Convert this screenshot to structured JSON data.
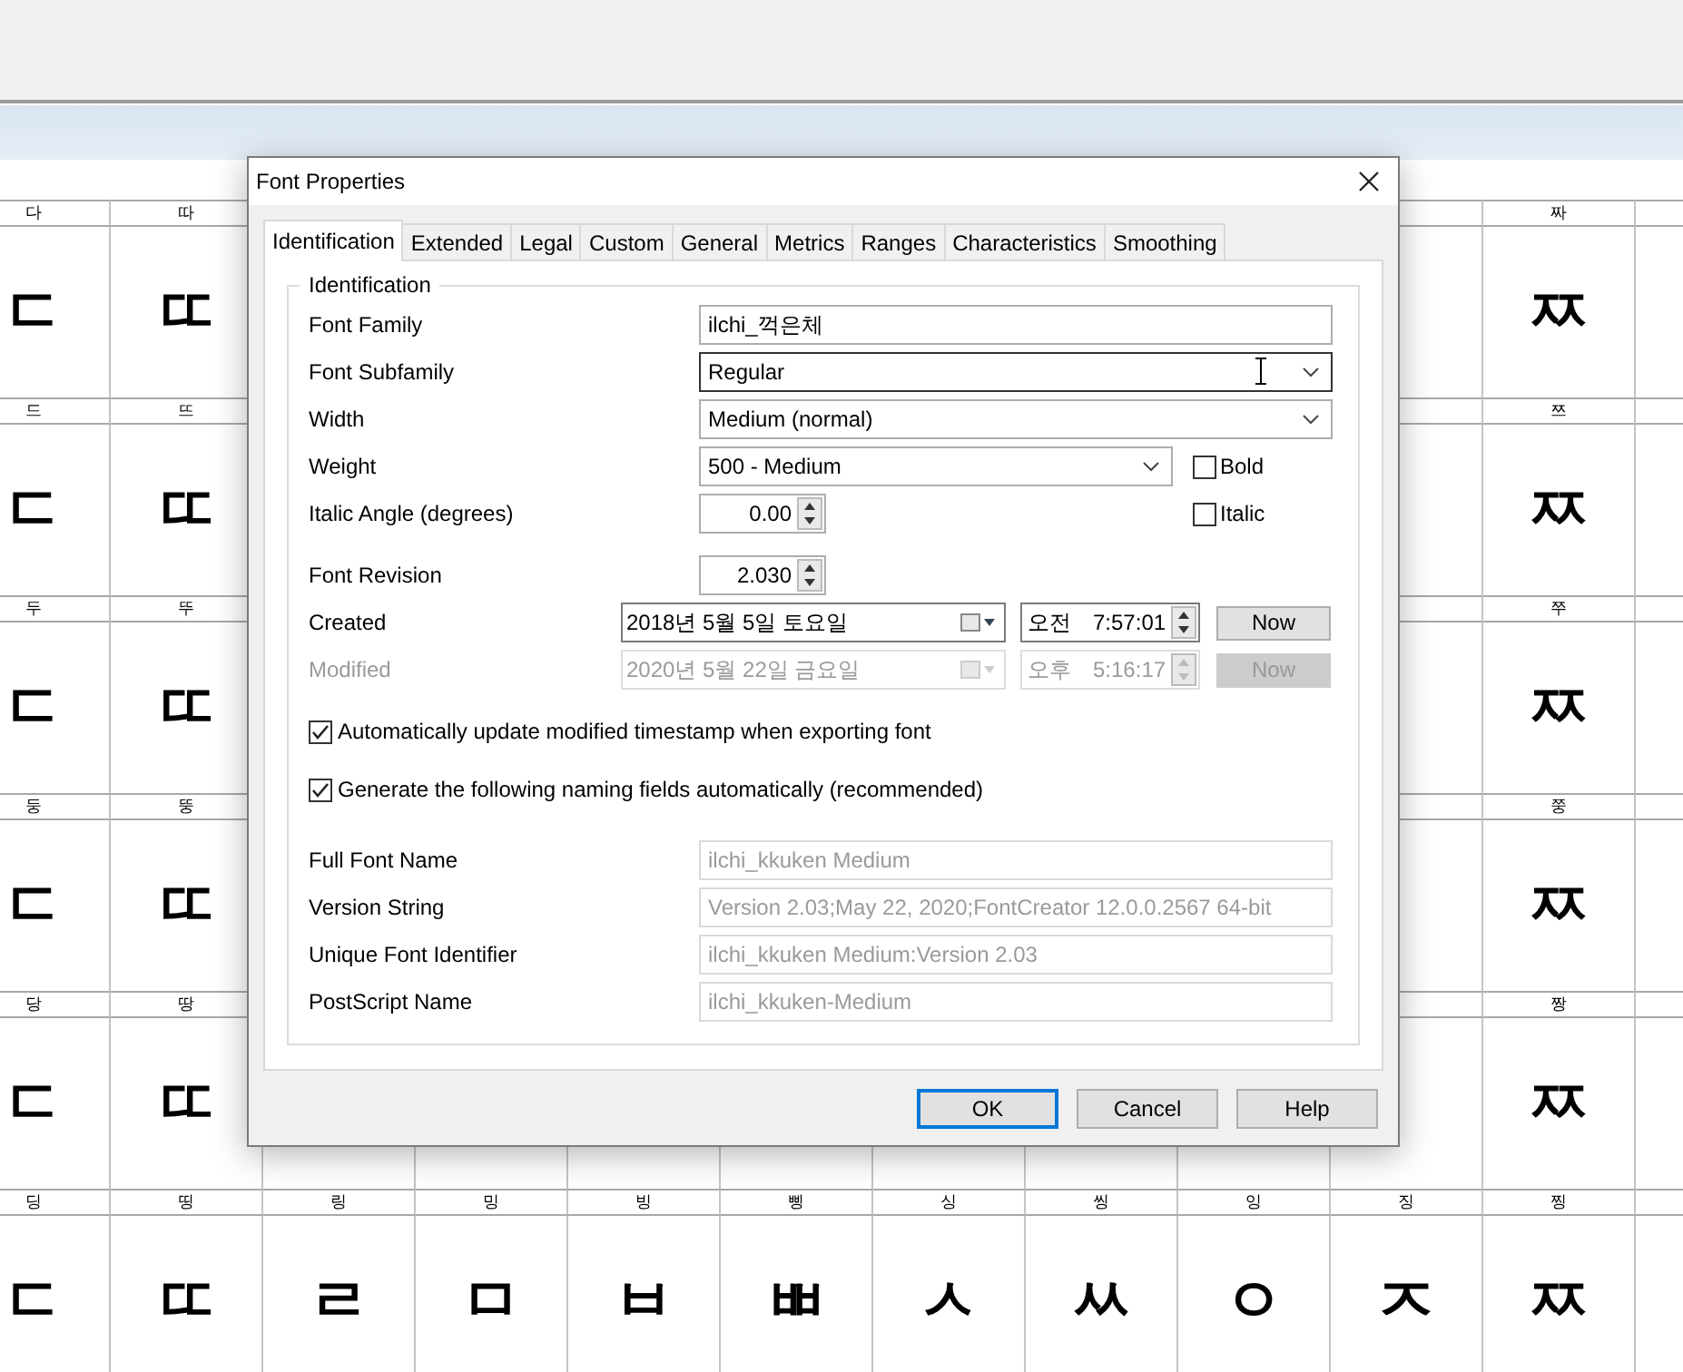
{
  "background": {
    "rows": [
      {
        "left": [
          {
            "heading": "다",
            "glyph": "ㄷ"
          },
          {
            "heading": "따",
            "glyph": "ㄸ"
          }
        ],
        "right": [
          {
            "heading": "짜",
            "glyph": "ㅉ"
          }
        ]
      },
      {
        "left": [
          {
            "heading": "드",
            "glyph": "ㄷ"
          },
          {
            "heading": "뜨",
            "glyph": "ㄸ"
          }
        ],
        "right": [
          {
            "heading": "쯔",
            "glyph": "ㅉ"
          }
        ]
      },
      {
        "left": [
          {
            "heading": "두",
            "glyph": "ㄷ"
          },
          {
            "heading": "뚜",
            "glyph": "ㄸ"
          }
        ],
        "right": [
          {
            "heading": "쭈",
            "glyph": "ㅉ"
          }
        ]
      },
      {
        "left": [
          {
            "heading": "둥",
            "glyph": "ㄷ"
          },
          {
            "heading": "뚱",
            "glyph": "ㄸ"
          }
        ],
        "right": [
          {
            "heading": "쭝",
            "glyph": "ㅉ"
          }
        ]
      },
      {
        "left": [
          {
            "heading": "당",
            "glyph": "ㄷ"
          },
          {
            "heading": "땅",
            "glyph": "ㄸ"
          }
        ],
        "right": [
          {
            "heading": "짱",
            "glyph": "ㅉ"
          }
        ]
      }
    ],
    "last_row": [
      {
        "heading": "딩",
        "glyph": "ㄷ"
      },
      {
        "heading": "띵",
        "glyph": "ㄸ"
      },
      {
        "heading": "링",
        "glyph": "ㄹ"
      },
      {
        "heading": "밍",
        "glyph": "ㅁ"
      },
      {
        "heading": "빙",
        "glyph": "ㅂ"
      },
      {
        "heading": "삥",
        "glyph": "ㅃ"
      },
      {
        "heading": "싱",
        "glyph": "ㅅ"
      },
      {
        "heading": "씽",
        "glyph": "ㅆ"
      },
      {
        "heading": "잉",
        "glyph": "ㅇ"
      },
      {
        "heading": "징",
        "glyph": "ㅈ"
      },
      {
        "heading": "찡",
        "glyph": "ㅉ"
      }
    ]
  },
  "dialog": {
    "title": "Font Properties",
    "tabs": [
      {
        "label": "Identification",
        "selected": true
      },
      {
        "label": "Extended",
        "selected": false
      },
      {
        "label": "Legal",
        "selected": false
      },
      {
        "label": "Custom",
        "selected": false
      },
      {
        "label": "General",
        "selected": false
      },
      {
        "label": "Metrics",
        "selected": false
      },
      {
        "label": "Ranges",
        "selected": false
      },
      {
        "label": "Characteristics",
        "selected": false
      },
      {
        "label": "Smoothing",
        "selected": false
      }
    ],
    "group": "Identification",
    "fields": [
      {
        "kind": "text",
        "label": "Font Family",
        "value": "ilchi_꺽은체"
      },
      {
        "kind": "combo",
        "label": "Font Subfamily",
        "value": "Regular",
        "focused": true
      },
      {
        "kind": "combo",
        "label": "Width",
        "value": "Medium (normal)"
      },
      {
        "kind": "combo",
        "label": "Weight",
        "value": "500 - Medium",
        "side_checkbox": {
          "label": "Bold",
          "checked": false
        }
      },
      {
        "kind": "spin",
        "label": "Italic Angle (degrees)",
        "value": "0.00",
        "side_checkbox": {
          "label": "Italic",
          "checked": false
        }
      },
      {
        "kind": "spin",
        "label": "Font Revision",
        "value": "2.030"
      },
      {
        "kind": "datetime",
        "label": "Created",
        "date": "2018년  5월  5일 토요일",
        "ampm": "오전",
        "time": "7:57:01",
        "button": "Now",
        "disabled": false
      },
      {
        "kind": "datetime",
        "label": "Modified",
        "date": "2020년  5월 22일 금요일",
        "ampm": "오후",
        "time": "5:16:17",
        "button": "Now",
        "disabled": true
      }
    ],
    "checkboxes": [
      {
        "label": "Automatically update modified timestamp when exporting font",
        "checked": true
      },
      {
        "label": "Generate the following naming fields automatically (recommended)",
        "checked": true
      }
    ],
    "names": [
      {
        "label": "Full Font Name",
        "value": "ilchi_kkuken Medium",
        "disabled": true
      },
      {
        "label": "Version String",
        "value": "Version 2.03;May 22, 2020;FontCreator 12.0.0.2567 64-bit",
        "disabled": true
      },
      {
        "label": "Unique Font Identifier",
        "value": "ilchi_kkuken Medium:Version 2.03",
        "disabled": true
      },
      {
        "label": "PostScript Name",
        "value": "ilchi_kkuken-Medium",
        "disabled": true
      }
    ],
    "buttons": [
      {
        "label": "OK",
        "default": true
      },
      {
        "label": "Cancel",
        "default": false
      },
      {
        "label": "Help",
        "default": false
      }
    ]
  }
}
